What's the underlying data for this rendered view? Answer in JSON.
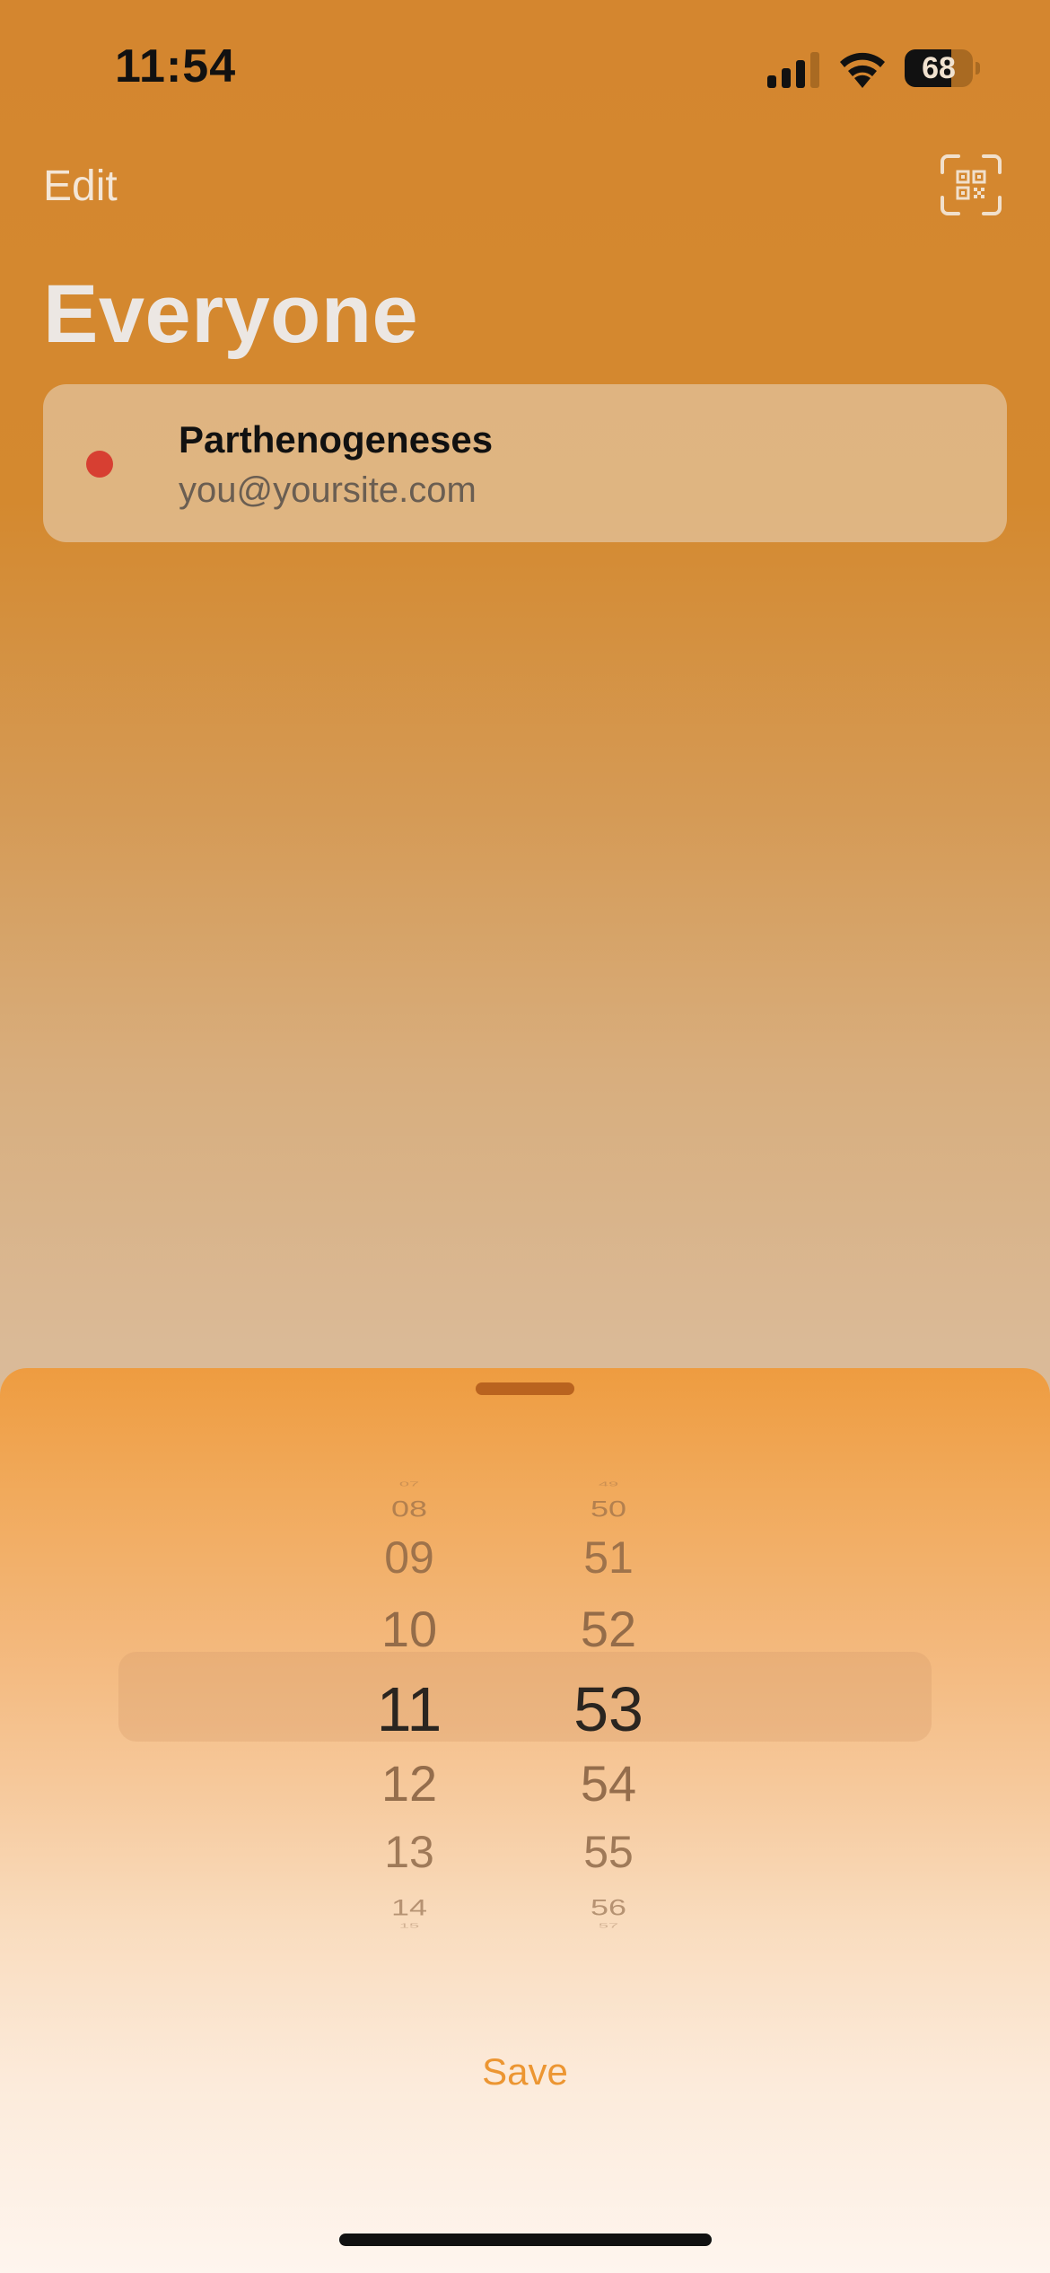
{
  "status_bar": {
    "time": "11:54",
    "battery_level": "68",
    "battery_fraction": 0.68
  },
  "nav": {
    "edit_label": "Edit",
    "qr_icon": "qr-code-scan-icon"
  },
  "page": {
    "title": "Everyone"
  },
  "contacts": [
    {
      "name": "Parthenogeneses",
      "email": "you@yoursite.com",
      "status_color": "#d73f32"
    }
  ],
  "time_picker": {
    "hours": [
      "07",
      "08",
      "09",
      "10",
      "11",
      "12",
      "13",
      "14",
      "15"
    ],
    "minutes": [
      "49",
      "50",
      "51",
      "52",
      "53",
      "54",
      "55",
      "56",
      "57"
    ],
    "selected_hour": "11",
    "selected_minute": "53"
  },
  "sheet": {
    "save_label": "Save"
  },
  "colors": {
    "accent": "#ec9632",
    "background_top": "#d4862f",
    "sheet_top": "#ee9c40",
    "status_dot": "#d73f32"
  }
}
